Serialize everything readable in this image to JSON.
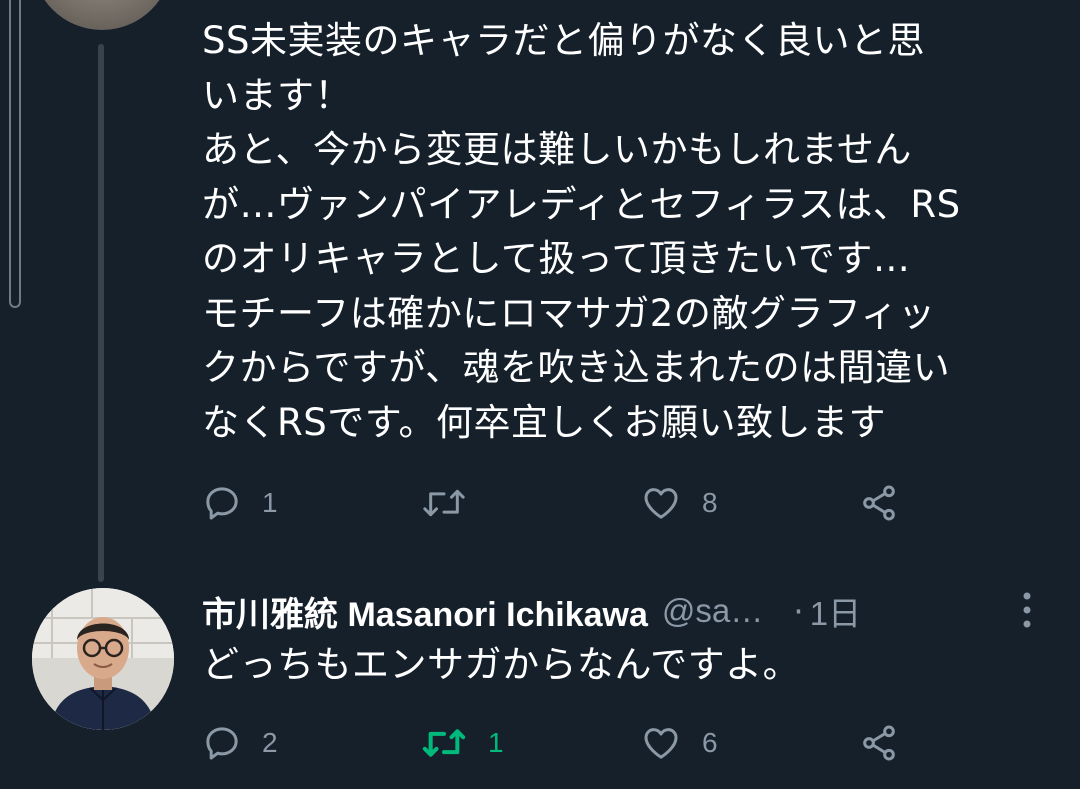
{
  "tweet1": {
    "lines": "SS未実装のキャラだと偏りがなく良いと思\nいます！\nあと、今から変更は難しいかもしれません\nが…ヴァンパイアレディとセフィラスは、RS\nのオリキャラとして扱って頂きたいです…\nモチーフは確かにロマサガ2の敵グラフィッ\nクからですが、魂を吹き込まれたのは間違い\nなくRSです。何卒宜しくお願い致します",
    "reply_count": "1",
    "retweet_count": "",
    "like_count": "8"
  },
  "tweet2": {
    "name_jp": "市川雅統",
    "name_en": " Masanori  Ichikawa",
    "handle": "@sa…",
    "dot": "·",
    "time": "1日",
    "text": "どっちもエンサガからなんですよ。",
    "reply_count": "2",
    "retweet_count": "1",
    "like_count": "6"
  },
  "icons": {
    "reply": "reply-icon",
    "retweet": "retweet-icon",
    "like": "heart-icon",
    "share": "share-icon",
    "more": "more-vertical-icon"
  },
  "colors": {
    "background": "#15202b",
    "muted": "#8b98a5",
    "retweet_active": "#00ba7c",
    "thread_line": "#38444d"
  }
}
